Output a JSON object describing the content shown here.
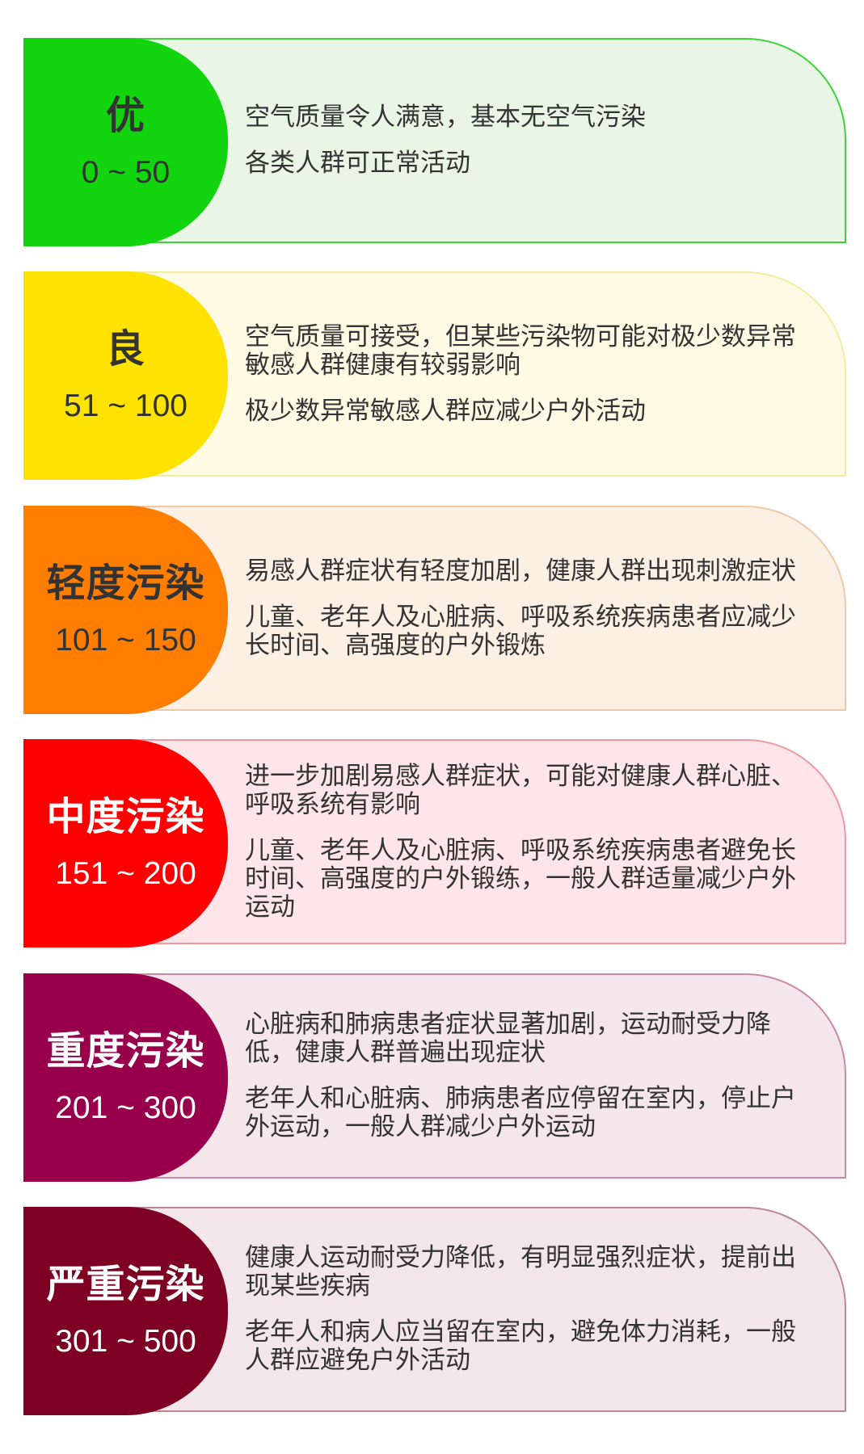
{
  "levels": [
    {
      "level": "优",
      "range": "0 ~ 50",
      "effect": "空气质量令人满意，基本无空气污染",
      "advice": "各类人群可正常活动",
      "badge_color": "#12D40F",
      "badge_text_color": "#333333",
      "card_bg": "#E9F6E6",
      "border_color": "#3DD43A"
    },
    {
      "level": "良",
      "range": "51 ~ 100",
      "effect": "空气质量可接受，但某些污染物可能对极少数异常敏感人群健康有较弱影响",
      "advice": "极少数异常敏感人群应减少户外活动",
      "badge_color": "#FFE300",
      "badge_text_color": "#333333",
      "card_bg": "#FEFAE4",
      "border_color": "#F1EDA0"
    },
    {
      "level": "轻度污染",
      "range": "101 ~ 150",
      "effect": "易感人群症状有轻度加剧，健康人群出现刺激症状",
      "advice": "儿童、老年人及心脏病、呼吸系统疾病患者应减少长时间、高强度的户外锻炼",
      "badge_color": "#FF7E00",
      "badge_text_color": "#333333",
      "card_bg": "#FCF0E4",
      "border_color": "#EFC9A3"
    },
    {
      "level": "中度污染",
      "range": "151 ~ 200",
      "effect": "进一步加剧易感人群症状，可能对健康人群心脏、呼吸系统有影响",
      "advice": "儿童、老年人及心脏病、呼吸系统疾病患者避免长时间、高强度的户外锻练，一般人群适量减少户外运动",
      "badge_color": "#FF0000",
      "badge_text_color": "#FFFFFF",
      "card_bg": "#FDE5E9",
      "border_color": "#EE9AA6"
    },
    {
      "level": "重度污染",
      "range": "201 ~ 300",
      "effect": "心脏病和肺病患者症状显著加剧，运动耐受力降低，健康人群普遍出现症状",
      "advice": "老年人和心脏病、肺病患者应停留在室内，停止户外运动，一般人群减少户外运动",
      "badge_color": "#99004C",
      "badge_text_color": "#FFFFFF",
      "card_bg": "#F5E6EC",
      "border_color": "#C98AA6"
    },
    {
      "level": "严重污染",
      "range": "301 ~ 500",
      "effect": "健康人运动耐受力降低，有明显强烈症状，提前出现某些疾病",
      "advice": "老年人和病人应当留在室内，避免体力消耗，一般人群应避免户外活动",
      "badge_color": "#7E0023",
      "badge_text_color": "#FFFFFF",
      "card_bg": "#F3E6EA",
      "border_color": "#BE8595"
    }
  ]
}
